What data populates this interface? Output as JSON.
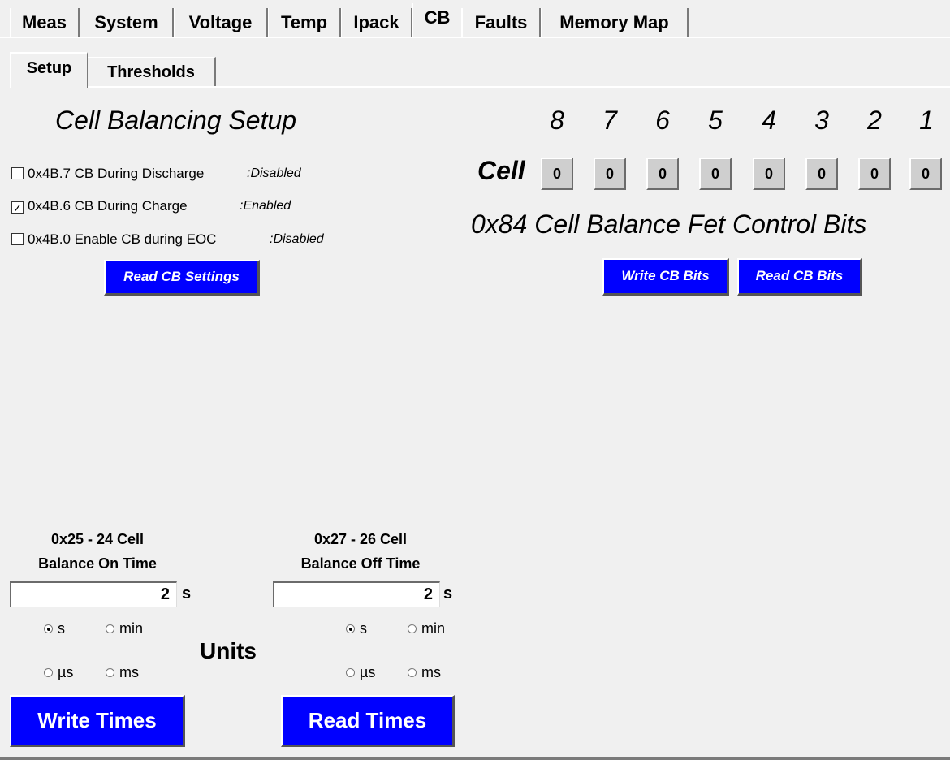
{
  "tabs": [
    "Meas",
    "System",
    "Voltage",
    "Temp",
    "Ipack",
    "CB",
    "Faults",
    "Memory Map"
  ],
  "active_tab": "CB",
  "subtabs": [
    "Setup",
    "Thresholds"
  ],
  "active_subtab": "Setup",
  "setup": {
    "title": "Cell Balancing Setup",
    "options": [
      {
        "checked": false,
        "check_mark": "",
        "label": "0x4B.7 CB During Discharge",
        "status": ":Disabled"
      },
      {
        "checked": true,
        "check_mark": "✓",
        "label": "0x4B.6 CB During Charge",
        "status": ":Enabled"
      },
      {
        "checked": false,
        "check_mark": "",
        "label": "0x4B.0 Enable CB during EOC",
        "status": ":Disabled"
      }
    ],
    "read_button": "Read CB Settings"
  },
  "cell_bits": {
    "numbers": [
      "8",
      "7",
      "6",
      "5",
      "4",
      "3",
      "2",
      "1"
    ],
    "row_label": "Cell",
    "values": [
      "0",
      "0",
      "0",
      "0",
      "0",
      "0",
      "0",
      "0"
    ],
    "caption": "0x84 Cell Balance Fet Control Bits",
    "write_button": "Write CB Bits",
    "read_button": "Read CB Bits"
  },
  "timing": {
    "on_time": {
      "label_line1": "0x25 - 24 Cell",
      "label_line2": "Balance On Time",
      "value": "2",
      "unit": "s",
      "radios": [
        {
          "label": "s",
          "selected": true
        },
        {
          "label": "min",
          "selected": false
        },
        {
          "label": "µs",
          "selected": false
        },
        {
          "label": "ms",
          "selected": false
        }
      ]
    },
    "off_time": {
      "label_line1": "0x27 - 26 Cell",
      "label_line2": "Balance Off Time",
      "value": "2",
      "unit": "s",
      "radios": [
        {
          "label": "s",
          "selected": true
        },
        {
          "label": "min",
          "selected": false
        },
        {
          "label": "µs",
          "selected": false
        },
        {
          "label": "ms",
          "selected": false
        }
      ]
    },
    "units_label": "Units",
    "write_button": "Write Times",
    "read_button": "Read Times"
  },
  "colors": {
    "button_blue": "#0000ff",
    "background": "#f0f0f0",
    "cell_button": "#cfcfcf"
  }
}
